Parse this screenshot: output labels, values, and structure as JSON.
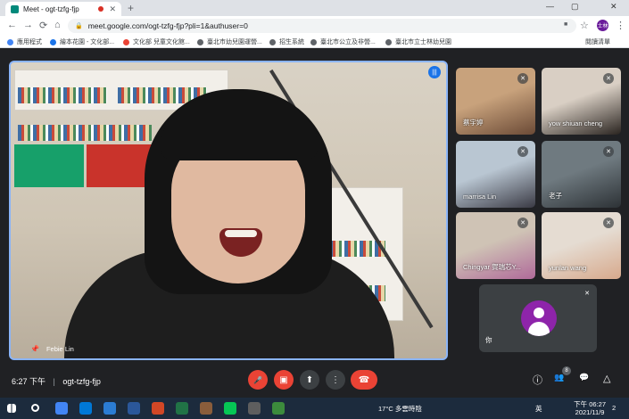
{
  "browser": {
    "tab_title": "Meet - ogt-tzfg-fjp",
    "tab_close": "✕",
    "new_tab": "+",
    "url": "meet.google.com/ogt-tzfg-fjp?pli=1&authuser=0",
    "window_min": "—",
    "window_max": "▢",
    "window_close": "✕",
    "back": "←",
    "forward": "→",
    "reload": "⟳",
    "home": "⌂",
    "lock": "🔒",
    "camera": "■",
    "star": "☆",
    "profile": "士林",
    "menu": "⋮",
    "reading_list": "閱讀清單",
    "bookmarks": [
      {
        "label": "應用程式",
        "color": "#4285f4"
      },
      {
        "label": "繪本花園 - 文化部...",
        "color": "#1a73e8"
      },
      {
        "label": "文化部 兒童文化館...",
        "color": "#ea4335"
      },
      {
        "label": "臺北市幼兒園運營...",
        "color": "#5f6368"
      },
      {
        "label": "招生系統",
        "color": "#5f6368"
      },
      {
        "label": "臺北市公立及非營...",
        "color": "#5f6368"
      },
      {
        "label": "臺北市立士林幼兒園",
        "color": "#5f6368"
      }
    ]
  },
  "meeting": {
    "main_speaker": "Febie Lin",
    "time": "6:27 下午",
    "separator": "|",
    "meeting_code": "ogt-tzfg-fjp",
    "people_count": "8",
    "self_label": "你",
    "participants": [
      {
        "name": "蔡宇婷",
        "colors": [
          "#c8a27c",
          "#6b4a36"
        ]
      },
      {
        "name": "yow shiuan cheng",
        "colors": [
          "#d9cfc4",
          "#2a2420"
        ]
      },
      {
        "name": "marrisa Lin",
        "colors": [
          "#b9c6d2",
          "#3a3a44"
        ]
      },
      {
        "name": "老子",
        "colors": [
          "#6f7a80",
          "#2d3236"
        ]
      },
      {
        "name": "Chingyar 賀瑞芯Y...",
        "colors": [
          "#cfc3b5",
          "#b06a9a"
        ]
      },
      {
        "name": "yunlan wang",
        "colors": [
          "#e5dcd2",
          "#d7a98c"
        ]
      }
    ]
  },
  "icons": {
    "mic_off": "🎤",
    "cam_off": "▣",
    "present": "⬆",
    "more": "⋮",
    "hangup": "☎",
    "info": "ⓘ",
    "people": "👥",
    "chat": "💬",
    "activities": "△",
    "muted": "✕",
    "pin": "📌",
    "speaking": "|||"
  },
  "taskbar": {
    "weather": "17°C 多雲時陰",
    "ime": "英",
    "time": "下午 06:27",
    "date": "2021/11/9",
    "notification": "2",
    "apps": [
      "#4285f4",
      "#0078d7",
      "#2b7cd3",
      "#2b579a",
      "#d24726",
      "#217346",
      "#8a5d3b",
      "#06c755",
      "#5e5e5e",
      "#3c8b3c"
    ]
  }
}
